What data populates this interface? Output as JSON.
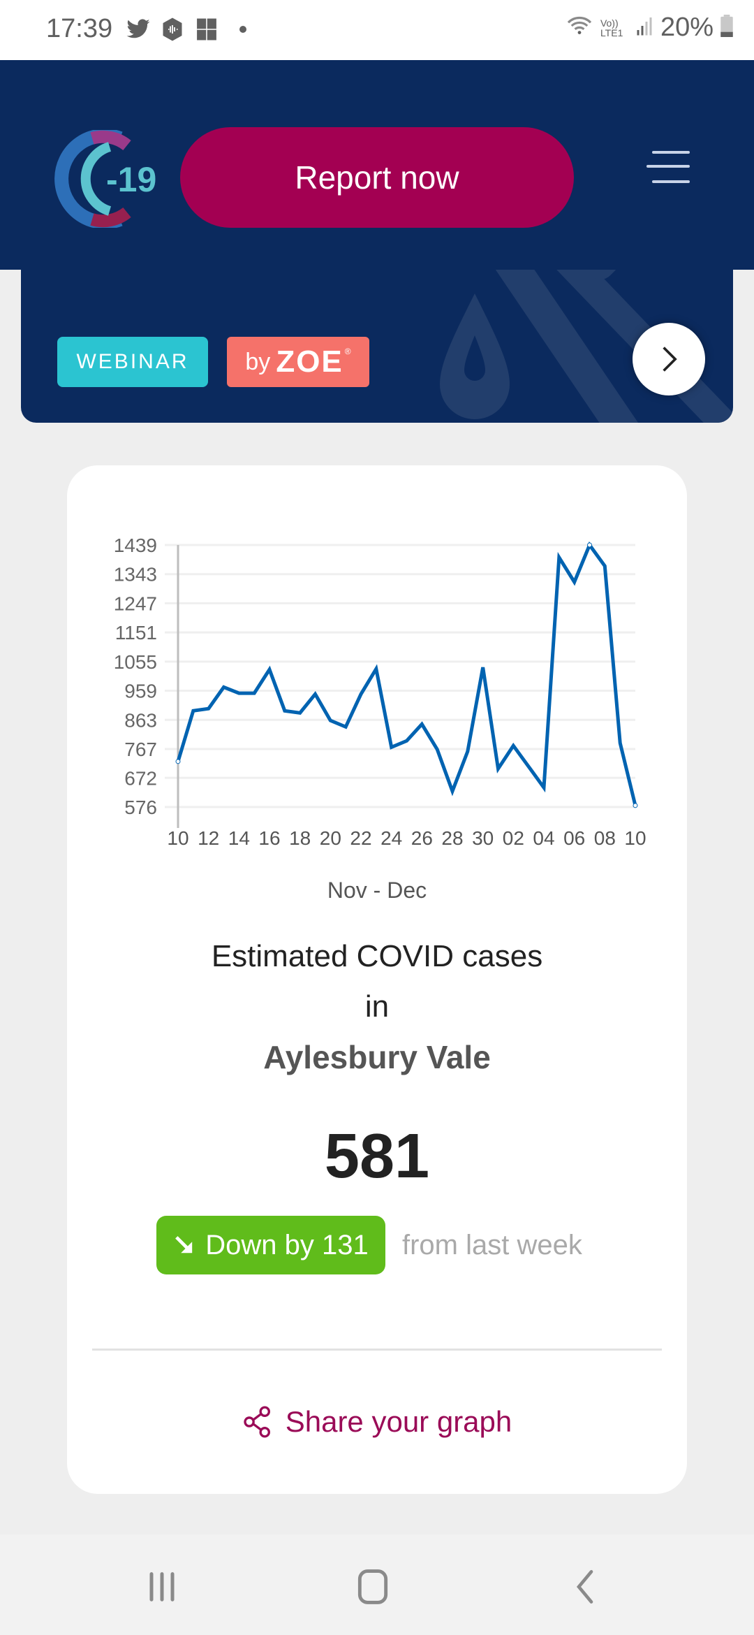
{
  "status_bar": {
    "time": "17:39",
    "notification_icons": [
      "twitter-icon",
      "podcast-icon",
      "puzzle-app-icon",
      "more-dot-icon"
    ],
    "network": "Vo)) LTE1",
    "battery": "20%"
  },
  "header": {
    "logo_text": "-19",
    "report_button": "Report now",
    "menu_icon": "hamburger-menu-icon"
  },
  "banner": {
    "tag_webinar": "WEBINAR",
    "tag_by": "by",
    "tag_brand": "ZOE",
    "tag_reg": "®",
    "next_icon": "chevron-right-icon"
  },
  "card": {
    "title_line1": "Estimated COVID cases",
    "title_line2": "in",
    "region": "Aylesbury Vale",
    "value": "581",
    "change_label": "Down by 131",
    "change_suffix": "from last week",
    "share_label": "Share your graph"
  },
  "colors": {
    "header_bg": "#0b2a5e",
    "accent": "#a30052",
    "line": "#0063b1",
    "down_badge": "#60bc1b",
    "webinar": "#2bc4d1",
    "zoe": "#f5726a"
  },
  "chart_data": {
    "type": "line",
    "title": "",
    "xlabel": "Nov - Dec",
    "ylabel": "",
    "x": [
      "10 Nov",
      "11 Nov",
      "12 Nov",
      "13 Nov",
      "14 Nov",
      "15 Nov",
      "16 Nov",
      "17 Nov",
      "18 Nov",
      "19 Nov",
      "20 Nov",
      "21 Nov",
      "22 Nov",
      "23 Nov",
      "24 Nov",
      "25 Nov",
      "26 Nov",
      "27 Nov",
      "28 Nov",
      "29 Nov",
      "30 Nov",
      "01 Dec",
      "02 Dec",
      "03 Dec",
      "04 Dec",
      "05 Dec",
      "06 Dec",
      "07 Dec",
      "08 Dec",
      "09 Dec",
      "10 Dec"
    ],
    "x_tick_labels": [
      "10",
      "12",
      "14",
      "16",
      "18",
      "20",
      "22",
      "24",
      "26",
      "28",
      "30",
      "02",
      "04",
      "06",
      "08",
      "10"
    ],
    "y_ticks": [
      576,
      672,
      767,
      863,
      959,
      1055,
      1151,
      1247,
      1343,
      1439
    ],
    "ylim": [
      576,
      1439
    ],
    "grid": true,
    "legend": "none",
    "series": [
      {
        "name": "Estimated COVID cases",
        "values": [
          726,
          893,
          900,
          971,
          951,
          951,
          1029,
          893,
          886,
          948,
          861,
          840,
          948,
          1031,
          773,
          794,
          849,
          766,
          628,
          759,
          1036,
          702,
          778,
          709,
          640,
          1398,
          1317,
          1439,
          1370,
          787,
          581
        ]
      }
    ]
  }
}
